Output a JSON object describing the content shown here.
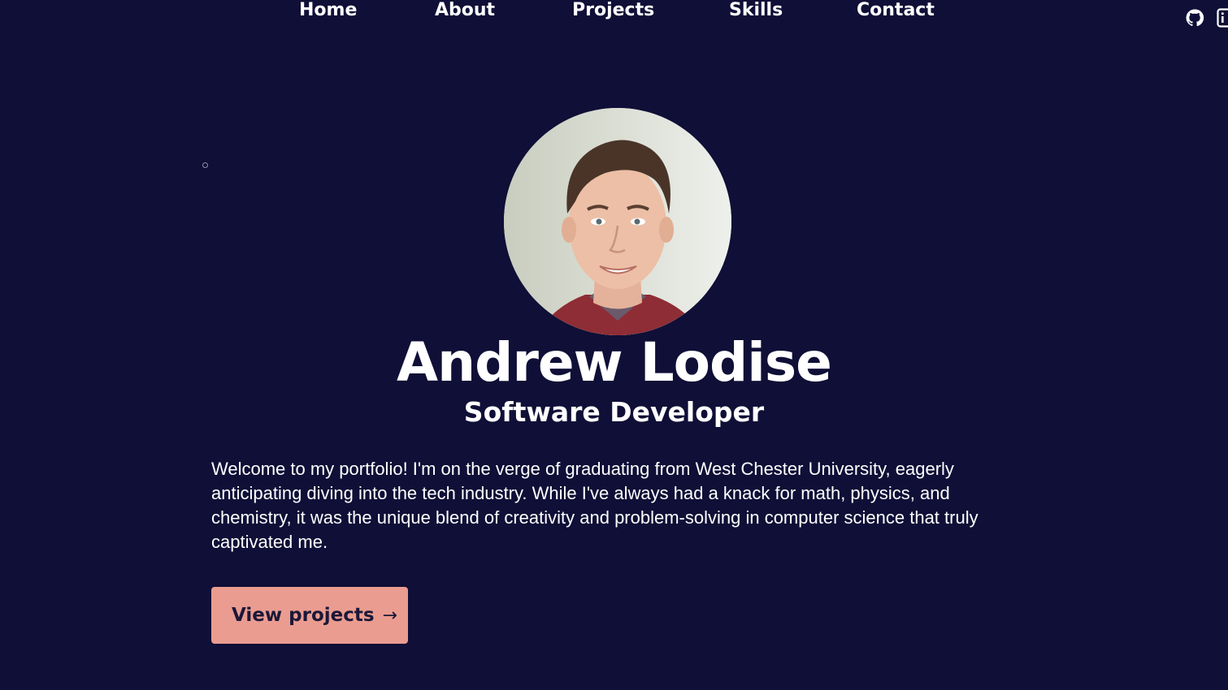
{
  "nav": {
    "links": [
      "Home",
      "About",
      "Projects",
      "Skills",
      "Contact"
    ],
    "icons": [
      "github-icon",
      "linkedin-icon"
    ]
  },
  "hero": {
    "name": "Andrew Lodise",
    "role": "Software Developer",
    "intro": "Welcome to my portfolio! I'm on the verge of graduating from West Chester University, eagerly anticipating diving into the tech industry. While I've always had a knack for math, physics, and chemistry, it was the unique blend of creativity and problem-solving in computer science that truly captivated me.",
    "cta_label": "View projects",
    "cta_icon": "arrow-right-icon"
  },
  "colors": {
    "background": "#0f0f37",
    "accent": "#eb9c90",
    "text": "#ffffff"
  }
}
